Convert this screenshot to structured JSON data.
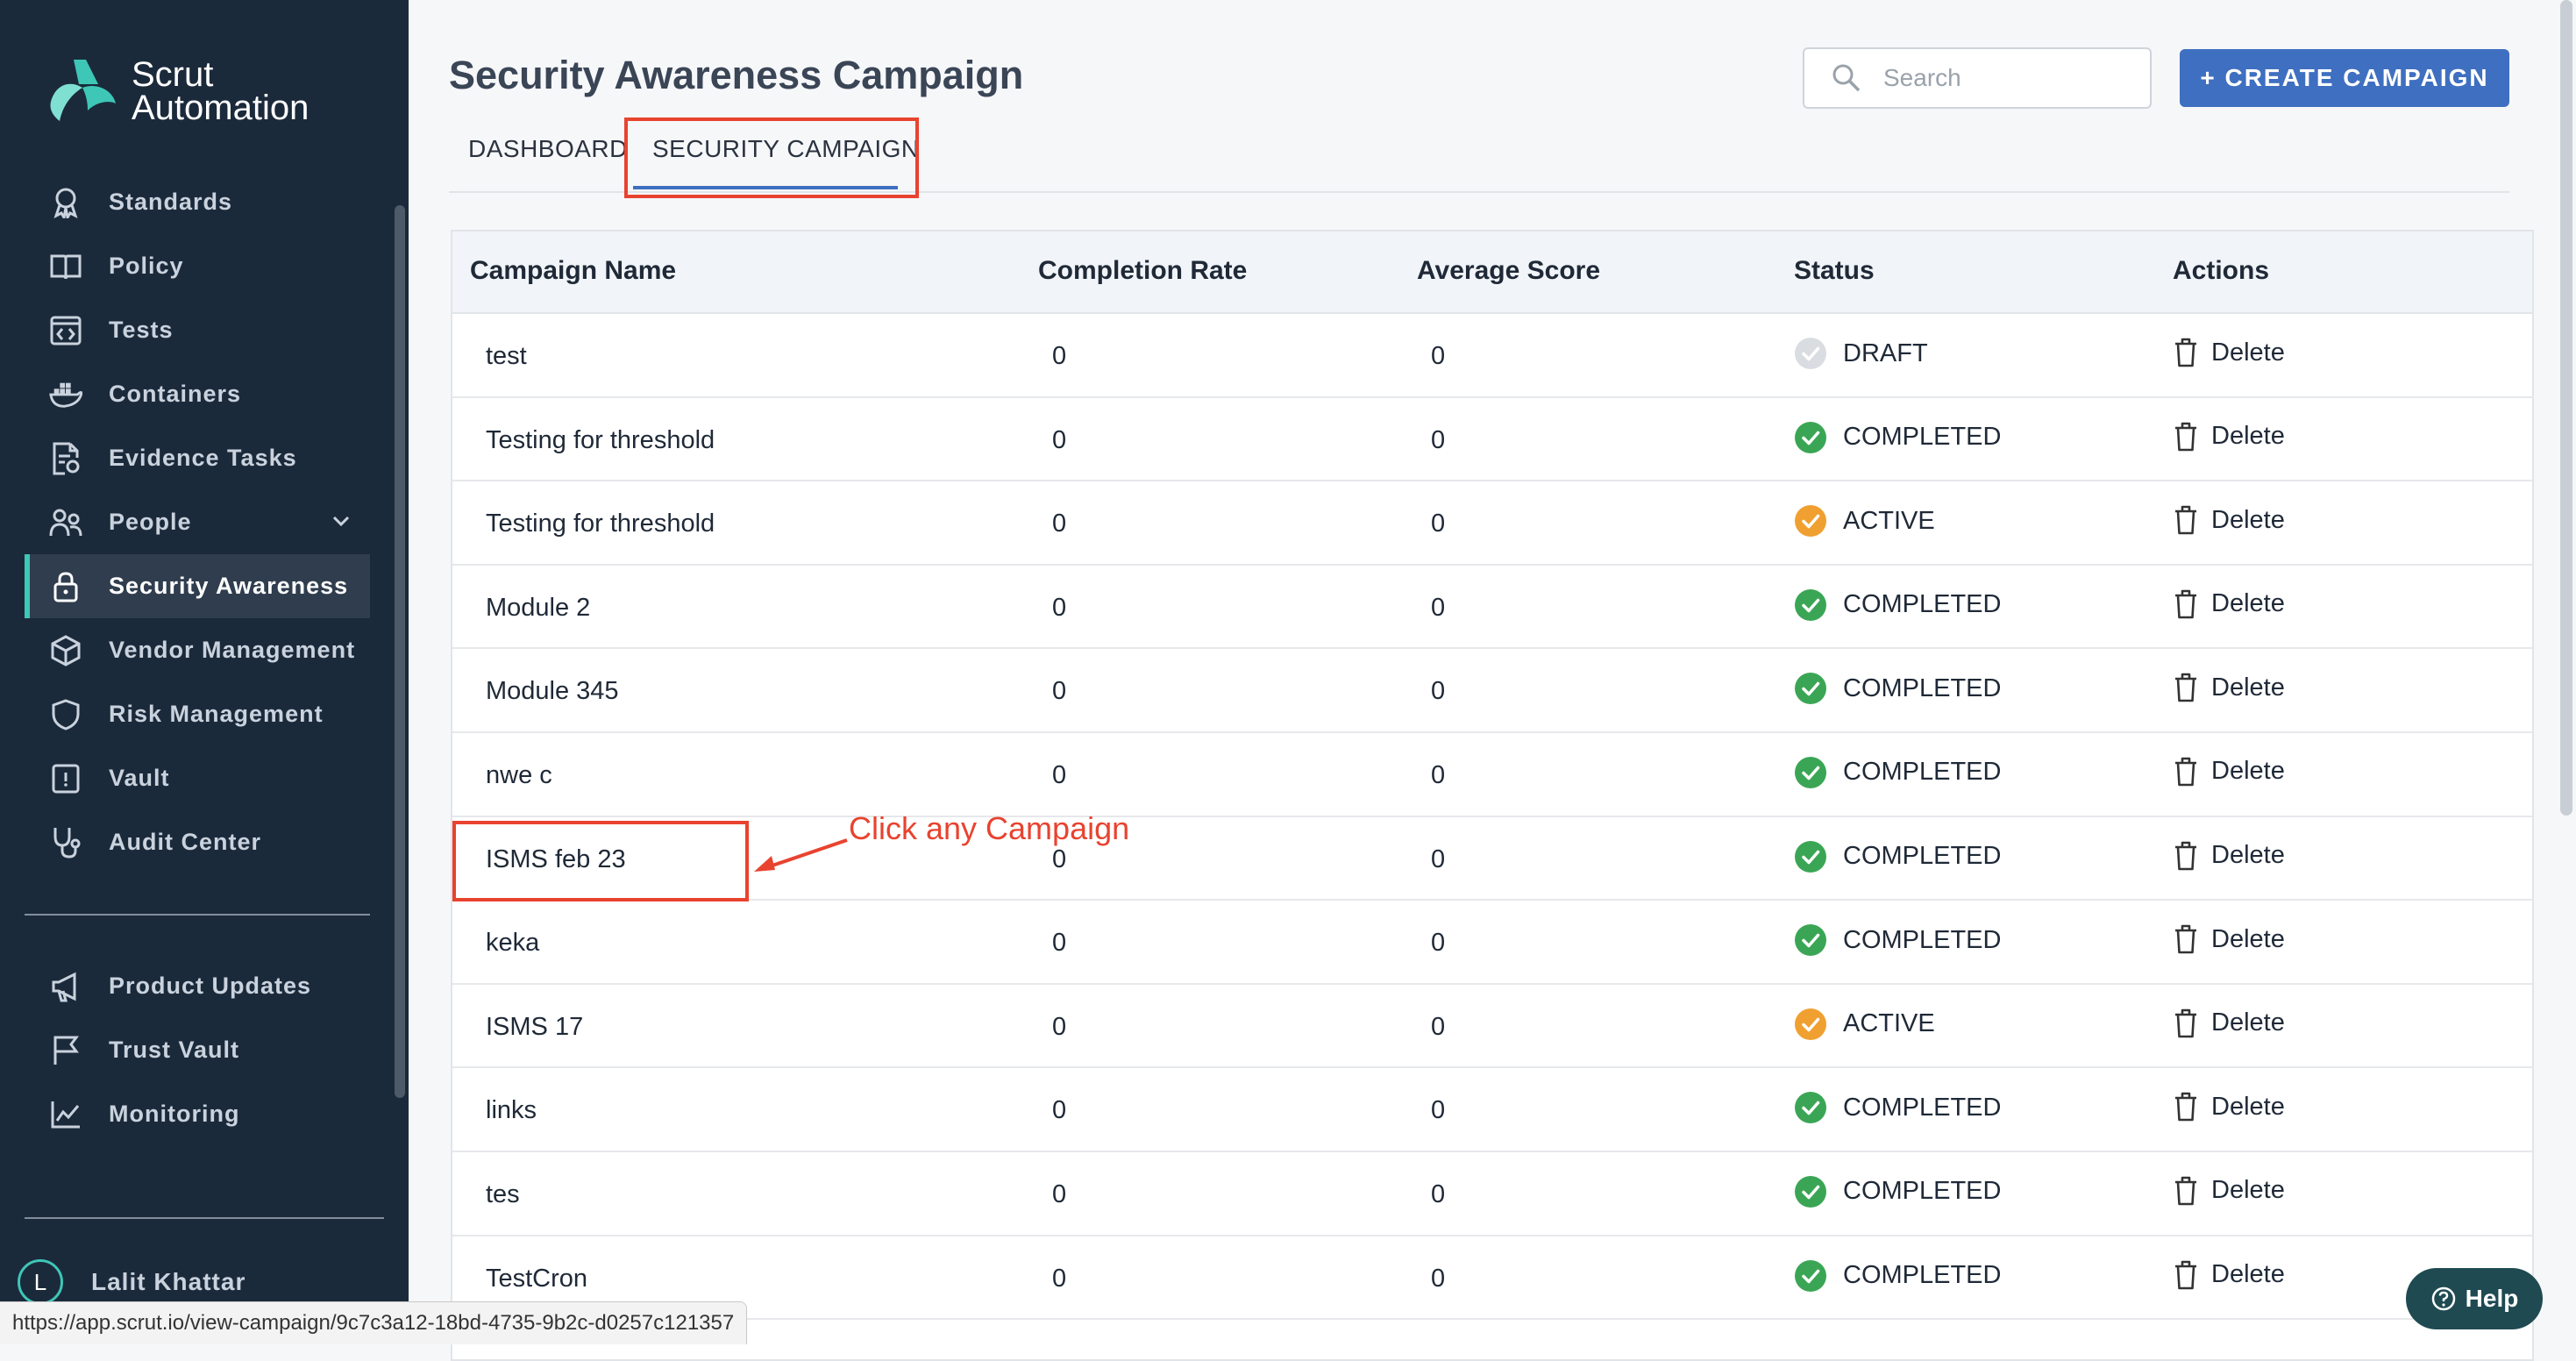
{
  "brand": {
    "line1": "Scrut",
    "line2": "Automation"
  },
  "sidebar": {
    "items": [
      {
        "label": "Standards",
        "icon": "ribbon-icon"
      },
      {
        "label": "Policy",
        "icon": "book-icon"
      },
      {
        "label": "Tests",
        "icon": "code-window-icon"
      },
      {
        "label": "Containers",
        "icon": "docker-icon"
      },
      {
        "label": "Evidence Tasks",
        "icon": "document-gear-icon"
      },
      {
        "label": "People",
        "icon": "people-icon"
      },
      {
        "label": "Security Awareness",
        "icon": "lock-icon",
        "active": true
      },
      {
        "label": "Vendor Management",
        "icon": "box-icon"
      },
      {
        "label": "Risk Management",
        "icon": "shield-icon"
      },
      {
        "label": "Vault",
        "icon": "vault-icon"
      },
      {
        "label": "Audit Center",
        "icon": "stethoscope-icon"
      }
    ],
    "secondary": [
      {
        "label": "Product Updates",
        "icon": "megaphone-icon"
      },
      {
        "label": "Trust Vault",
        "icon": "flag-icon"
      },
      {
        "label": "Monitoring",
        "icon": "chart-line-icon"
      }
    ],
    "user": {
      "initial": "L",
      "name": "Lalit Khattar"
    }
  },
  "header": {
    "title": "Security Awareness Campaign",
    "search_placeholder": "Search",
    "create_label": "+ CREATE CAMPAIGN"
  },
  "tabs": [
    {
      "label": "DASHBOARD"
    },
    {
      "label": "SECURITY CAMPAIGN",
      "active": true
    }
  ],
  "table": {
    "columns": [
      "Campaign Name",
      "Completion Rate",
      "Average Score",
      "Status",
      "Actions"
    ],
    "rows": [
      {
        "name": "test",
        "rate": "0",
        "score": "0",
        "status": "DRAFT",
        "action": "Delete"
      },
      {
        "name": "Testing for threshold",
        "rate": "0",
        "score": "0",
        "status": "COMPLETED",
        "action": "Delete"
      },
      {
        "name": "Testing for threshold",
        "rate": "0",
        "score": "0",
        "status": "ACTIVE",
        "action": "Delete"
      },
      {
        "name": "Module 2",
        "rate": "0",
        "score": "0",
        "status": "COMPLETED",
        "action": "Delete"
      },
      {
        "name": "Module 345",
        "rate": "0",
        "score": "0",
        "status": "COMPLETED",
        "action": "Delete"
      },
      {
        "name": "nwe c",
        "rate": "0",
        "score": "0",
        "status": "COMPLETED",
        "action": "Delete"
      },
      {
        "name": "ISMS feb 23",
        "rate": "0",
        "score": "0",
        "status": "COMPLETED",
        "action": "Delete"
      },
      {
        "name": "keka",
        "rate": "0",
        "score": "0",
        "status": "COMPLETED",
        "action": "Delete"
      },
      {
        "name": "ISMS 17",
        "rate": "0",
        "score": "0",
        "status": "ACTIVE",
        "action": "Delete"
      },
      {
        "name": "links",
        "rate": "0",
        "score": "0",
        "status": "COMPLETED",
        "action": "Delete"
      },
      {
        "name": "tes",
        "rate": "0",
        "score": "0",
        "status": "COMPLETED",
        "action": "Delete"
      },
      {
        "name": "TestCron",
        "rate": "0",
        "score": "0",
        "status": "COMPLETED",
        "action": "Delete"
      }
    ]
  },
  "status_colors": {
    "COMPLETED": "#3aa655",
    "ACTIVE": "#f0a030",
    "DRAFT": "#d9dde2"
  },
  "annotation": {
    "text": "Click any Campaign"
  },
  "status_url": "https://app.scrut.io/view-campaign/9c7c3a12-18bd-4735-9b2c-d0257c121357",
  "help": {
    "label": "Help"
  }
}
